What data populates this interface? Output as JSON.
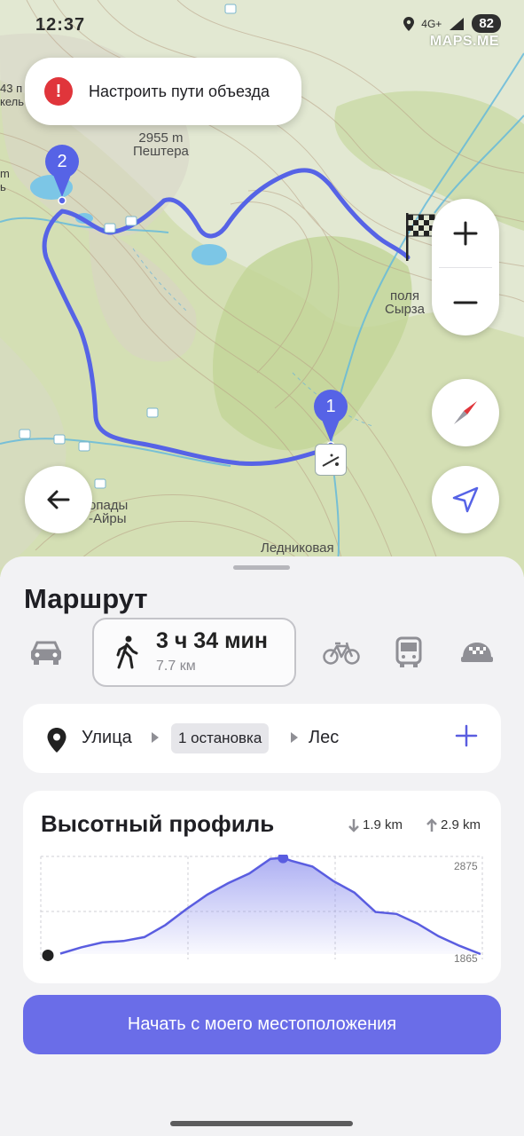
{
  "status_bar": {
    "time": "12:37",
    "network": "4G+",
    "battery": "82"
  },
  "map": {
    "watermark": "MAPS.ME",
    "labels": {
      "peak": "2955 m",
      "peak_name": "Пештера",
      "left_top_1": "43 п",
      "left_top_2": "кель",
      "left_mid_1": "m",
      "left_mid_2": "ь",
      "field_1": "поля",
      "field_2": "Сырза",
      "falls_1": "опады",
      "falls_2": "-Айры",
      "bottom": "Ледниковая"
    },
    "waypoints": [
      "1",
      "2"
    ],
    "route_color": "#5663e6"
  },
  "toast": {
    "icon": "!",
    "text": "Настроить пути объезда"
  },
  "panel": {
    "title": "Маршрут",
    "walk": {
      "time": "3 ч 34 мин",
      "distance": "7.7 км"
    },
    "route": {
      "from": "Улица",
      "stops": "1 остановка",
      "to": "Лес",
      "add": "+"
    },
    "elevation": {
      "title": "Высотный профиль",
      "descent": "1.9 km",
      "ascent": "2.9 km",
      "max_label": "2875",
      "min_label": "1865"
    },
    "start_button": "Начать с моего местоположения"
  },
  "chart_data": {
    "type": "area",
    "title": "Высотный профиль",
    "xlabel": "",
    "ylabel": "",
    "x": [
      0,
      0.05,
      0.1,
      0.15,
      0.2,
      0.25,
      0.3,
      0.35,
      0.4,
      0.45,
      0.5,
      0.53,
      0.55,
      0.6,
      0.65,
      0.7,
      0.75,
      0.8,
      0.85,
      0.9,
      0.95,
      1.0
    ],
    "values": [
      1870,
      1935,
      1985,
      2000,
      2040,
      2165,
      2330,
      2480,
      2600,
      2700,
      2850,
      2860,
      2830,
      2770,
      2620,
      2500,
      2300,
      2280,
      2180,
      2050,
      1950,
      1865
    ],
    "ylim": [
      1865,
      2875
    ],
    "y_tick_labels": [
      "2875",
      "1865"
    ],
    "grid": true
  }
}
